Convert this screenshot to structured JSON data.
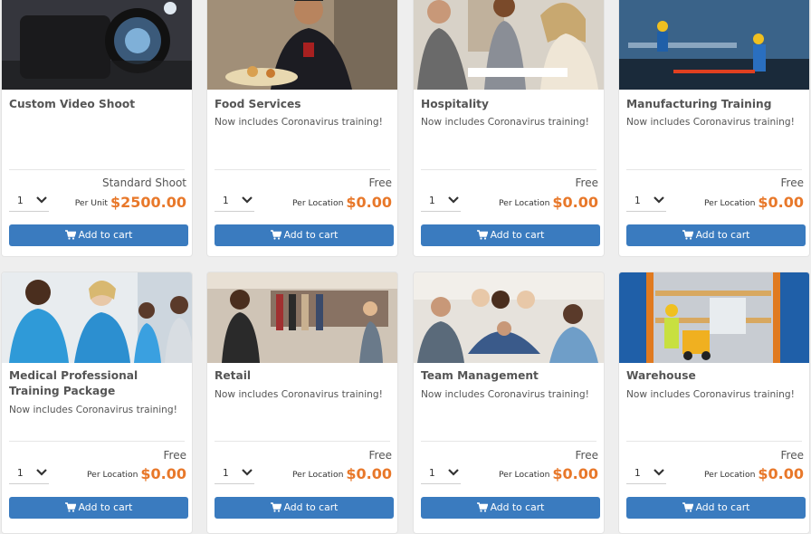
{
  "products": [
    {
      "title": "Custom Video Shoot",
      "subtitle": "",
      "price_label": "Standard Shoot",
      "quantity": "1",
      "unit_label": "Per Unit",
      "price": "$2500.00",
      "button_label": "Add to cart",
      "image_icon": "video-camera-image"
    },
    {
      "title": "Food Services",
      "subtitle": "Now includes Coronavirus training!",
      "price_label": "Free",
      "quantity": "1",
      "unit_label": "Per Location",
      "price": "$0.00",
      "button_label": "Add to cart",
      "image_icon": "chef-image"
    },
    {
      "title": "Hospitality",
      "subtitle": "Now includes Coronavirus training!",
      "price_label": "Free",
      "quantity": "1",
      "unit_label": "Per Location",
      "price": "$0.00",
      "button_label": "Add to cart",
      "image_icon": "handshake-image"
    },
    {
      "title": "Manufacturing Training",
      "subtitle": "Now includes Coronavirus training!",
      "price_label": "Free",
      "quantity": "1",
      "unit_label": "Per Location",
      "price": "$0.00",
      "button_label": "Add to cart",
      "image_icon": "factory-workers-image"
    },
    {
      "title": "Medical Professional Training Package",
      "subtitle": "Now includes Coronavirus training!",
      "price_label": "Free",
      "quantity": "1",
      "unit_label": "Per Location",
      "price": "$0.00",
      "button_label": "Add to cart",
      "image_icon": "medical-staff-image"
    },
    {
      "title": "Retail",
      "subtitle": "Now includes Coronavirus training!",
      "price_label": "Free",
      "quantity": "1",
      "unit_label": "Per Location",
      "price": "$0.00",
      "button_label": "Add to cart",
      "image_icon": "clothing-store-image"
    },
    {
      "title": "Team Management",
      "subtitle": "Now includes Coronavirus training!",
      "price_label": "Free",
      "quantity": "1",
      "unit_label": "Per Location",
      "price": "$0.00",
      "button_label": "Add to cart",
      "image_icon": "team-huddle-image"
    },
    {
      "title": "Warehouse",
      "subtitle": "Now includes Coronavirus training!",
      "price_label": "Free",
      "quantity": "1",
      "unit_label": "Per Location",
      "price": "$0.00",
      "button_label": "Add to cart",
      "image_icon": "warehouse-forklift-image"
    }
  ],
  "colors": {
    "accent_price": "#e8782a",
    "button": "#3a7bbf",
    "page_background": "#eeeeee"
  }
}
